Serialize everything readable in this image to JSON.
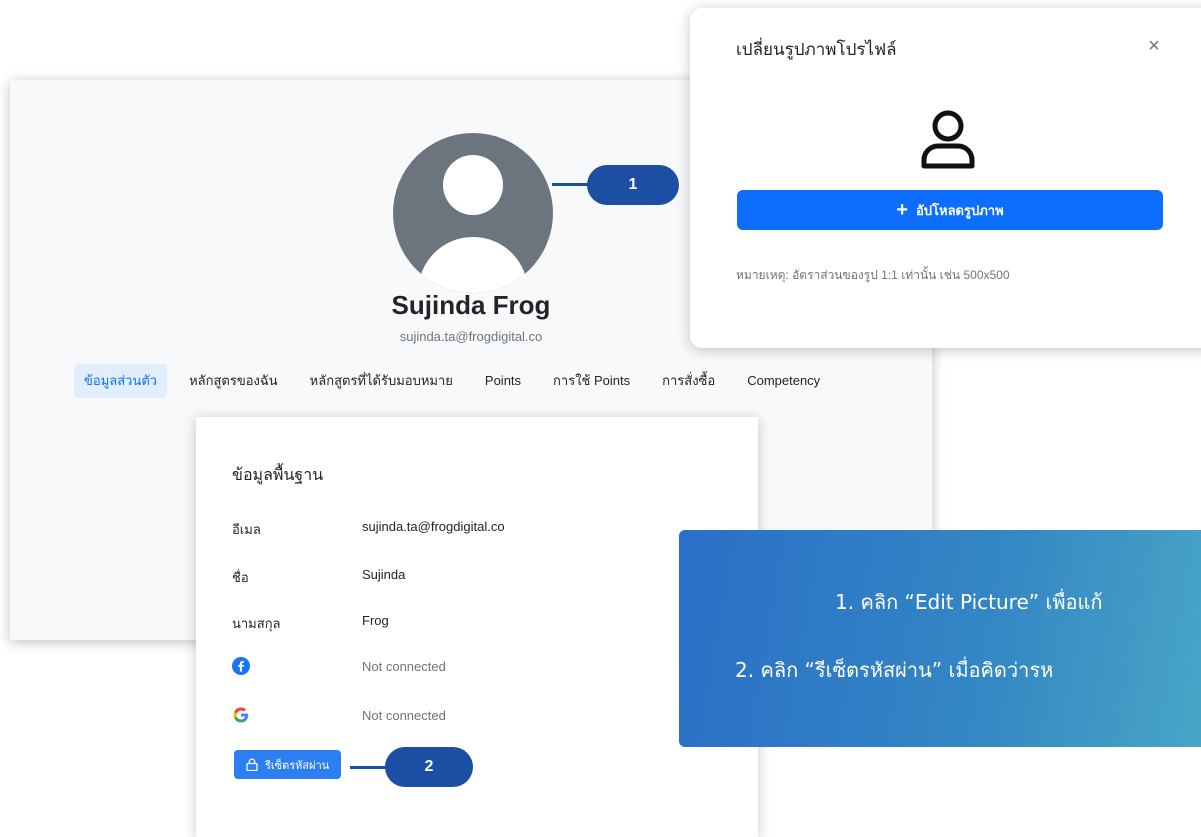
{
  "profile": {
    "name": "Sujinda Frog",
    "email": "sujinda.ta@frogdigital.co",
    "tabs": [
      {
        "label": "ข้อมูลส่วนตัว",
        "active": true
      },
      {
        "label": "หลักสูตรของฉัน",
        "active": false
      },
      {
        "label": "หลักสูตรที่ได้รับมอบหมาย",
        "active": false
      },
      {
        "label": "Points",
        "active": false
      },
      {
        "label": "การใช้ Points",
        "active": false
      },
      {
        "label": "การสั่งซื้อ",
        "active": false
      },
      {
        "label": "Competency",
        "active": false
      }
    ]
  },
  "basic_info": {
    "title": "ข้อมูลพื้นฐาน",
    "rows": [
      {
        "label": "อีเมล",
        "value": "sujinda.ta@frogdigital.co"
      },
      {
        "label": "ชื่อ",
        "value": "Sujinda"
      },
      {
        "label": "นามสกุล",
        "value": "Frog"
      }
    ],
    "social": [
      {
        "icon": "facebook-icon",
        "status": "Not connected"
      },
      {
        "icon": "google-icon",
        "status": "Not connected"
      }
    ],
    "reset_password_label": "รีเซ็ตรหัสผ่าน"
  },
  "steps": {
    "step1": "1",
    "step2": "2"
  },
  "modal": {
    "title": "เปลี่ยนรูปภาพโปรไฟล์",
    "close_symbol": "×",
    "upload_label": "อัปโหลดรูปภาพ",
    "note": "หมายเหตุ: อัตราส่วนของรูป 1:1 เท่านั้น เช่น 500x500"
  },
  "instructions": {
    "line1": "1. คลิก “Edit Picture” เพื่อแก้",
    "line2": "2. คลิก “รีเซ็ตรหัสผ่าน” เมื่อคิดว่ารห"
  },
  "colors": {
    "primary": "#0d6efd",
    "badge": "#1c4fa3",
    "avatar": "#6c757d"
  }
}
